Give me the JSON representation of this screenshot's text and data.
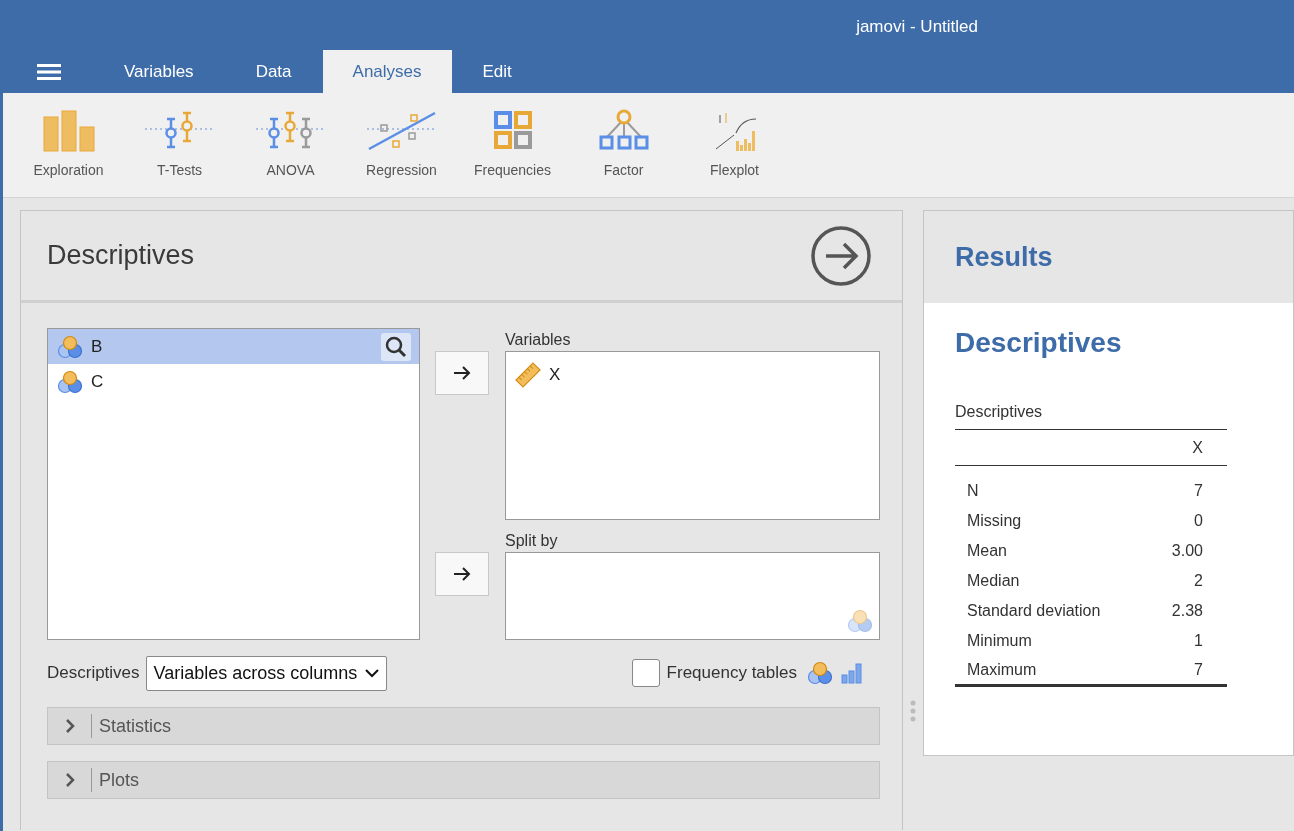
{
  "window": {
    "title": "jamovi - Untitled"
  },
  "tabs": [
    {
      "label": "Variables",
      "selected": false
    },
    {
      "label": "Data",
      "selected": false
    },
    {
      "label": "Analyses",
      "selected": true
    },
    {
      "label": "Edit",
      "selected": false
    }
  ],
  "ribbon": [
    {
      "label": "Exploration",
      "kind": "exploration"
    },
    {
      "label": "T-Tests",
      "kind": "ttests"
    },
    {
      "label": "ANOVA",
      "kind": "anova"
    },
    {
      "label": "Regression",
      "kind": "regression"
    },
    {
      "label": "Frequencies",
      "kind": "frequencies"
    },
    {
      "label": "Factor",
      "kind": "factor"
    },
    {
      "label": "Flexplot",
      "kind": "flexplot"
    }
  ],
  "analysis": {
    "title": "Descriptives",
    "source_variables": [
      {
        "name": "B",
        "kind": "nominal",
        "selected": true
      },
      {
        "name": "C",
        "kind": "nominal",
        "selected": false
      }
    ],
    "targets": [
      {
        "label": "Variables",
        "variables": [
          {
            "name": "X",
            "kind": "continuous"
          }
        ]
      },
      {
        "label": "Split by"
      }
    ],
    "layout_option": {
      "label": "Descriptives",
      "value": "Variables across columns"
    },
    "frequency_tables": {
      "label": "Frequency tables",
      "checked": false
    },
    "sections": [
      {
        "label": "Statistics",
        "expanded": false
      },
      {
        "label": "Plots",
        "expanded": false
      }
    ]
  },
  "results": {
    "header": "Results",
    "title": "Descriptives",
    "table": {
      "title": "Descriptives",
      "columns": [
        "X"
      ],
      "rows": [
        {
          "label": "N",
          "value": "7"
        },
        {
          "label": "Missing",
          "value": "0"
        },
        {
          "label": "Mean",
          "value": "3.00"
        },
        {
          "label": "Median",
          "value": "2"
        },
        {
          "label": "Standard deviation",
          "value": "2.38"
        },
        {
          "label": "Minimum",
          "value": "1"
        },
        {
          "label": "Maximum",
          "value": "7"
        }
      ]
    }
  }
}
